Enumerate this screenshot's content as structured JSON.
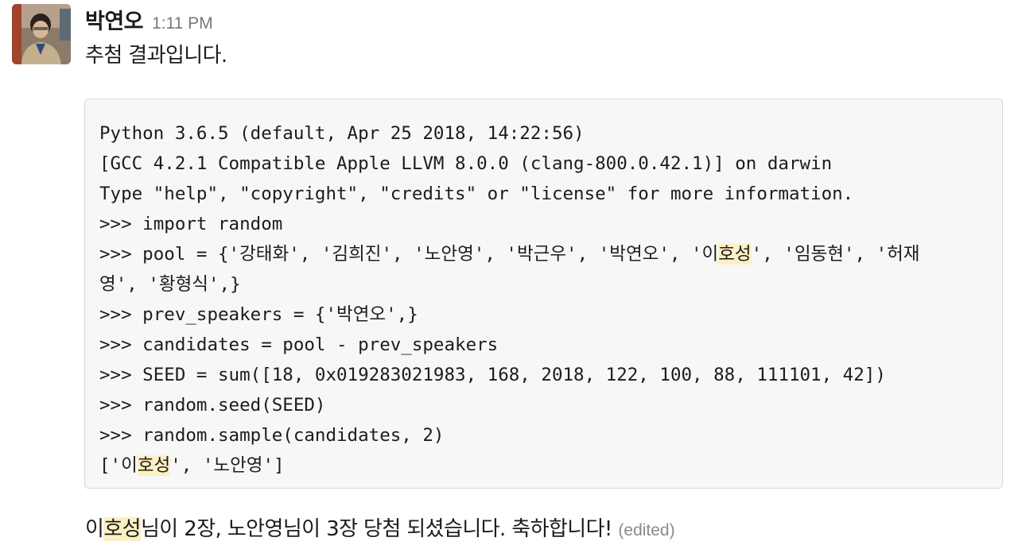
{
  "message": {
    "sender": "박연오",
    "timestamp": "1:11 PM",
    "text_first": "추첨 결과입니다.",
    "code_lines": [
      "Python 3.6.5 (default, Apr 25 2018, 14:22:56)",
      "[GCC 4.2.1 Compatible Apple LLVM 8.0.0 (clang-800.0.42.1)] on darwin",
      "Type \"help\", \"copyright\", \"credits\" or \"license\" for more information.",
      ">>> import random",
      ">>> pool = {'강태화', '김희진', '노안영', '박근우', '박연오', '이",
      "영', '황형식',}",
      ">>> prev_speakers = {'박연오',}",
      ">>> candidates = pool - prev_speakers",
      ">>> SEED = sum([18, 0x019283021983, 168, 2018, 122, 100, 88, 111101, 42])",
      ">>> random.seed(SEED)",
      ">>> random.sample(candidates, 2)",
      "['이"
    ],
    "code_line5_highlight": "호성",
    "code_line5_tail": "', '임동현', '허재",
    "code_line12_highlight": "호성",
    "code_line12_tail": "', '노안영']",
    "text_second_pre": "이",
    "text_second_highlight": "호성",
    "text_second_rest": "님이 2장, 노안영님이 3장 당첨 되셨습니다. 축하합니다! ",
    "edited_label": "(edited)"
  },
  "avatar": {
    "icon": "user-photo-avatar"
  },
  "colors": {
    "highlight": "#fdf0c2",
    "code_background": "#f7f7f7",
    "code_border": "#d8d8d8",
    "text": "#1d1c1d",
    "muted": "#7a7a7a"
  }
}
